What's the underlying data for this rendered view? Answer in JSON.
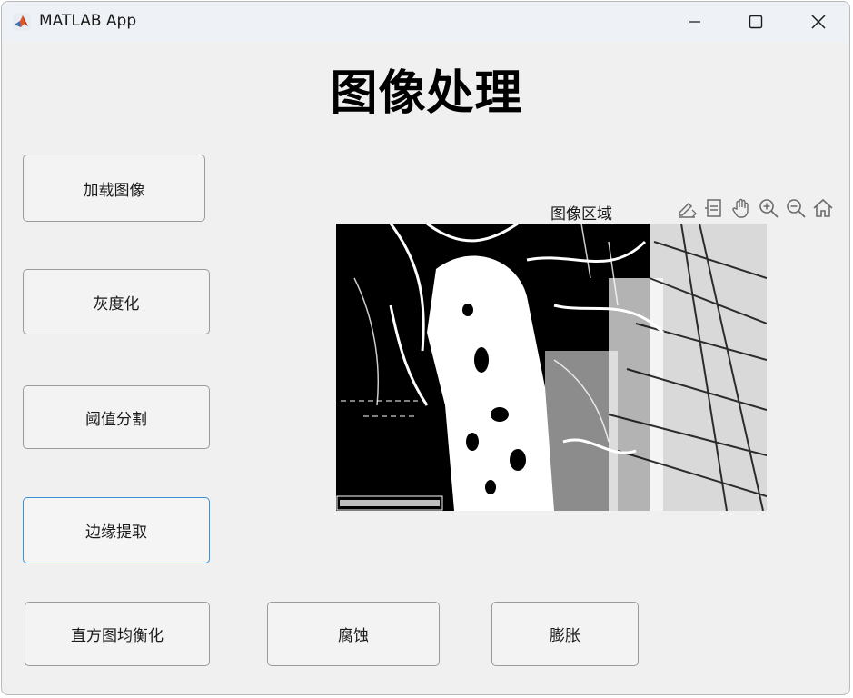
{
  "window": {
    "title": "MATLAB App",
    "controls": [
      "minimize-icon",
      "maximize-icon",
      "close-icon"
    ]
  },
  "page": {
    "heading": "图像处理"
  },
  "buttons": {
    "load_image": "加载图像",
    "grayscale": "灰度化",
    "threshold": "阈值分割",
    "edge": "边缘提取",
    "histeq": "直方图均衡化",
    "erode": "腐蚀",
    "dilate": "膨胀"
  },
  "axes": {
    "title": "图像区域",
    "toolbar": [
      "brush-icon",
      "data-tip-icon",
      "pan-hand-icon",
      "zoom-in-icon",
      "zoom-out-icon",
      "home-icon"
    ]
  },
  "colors": {
    "focus_border": "#3c8fd6",
    "window_bg": "#f0f0f0"
  }
}
